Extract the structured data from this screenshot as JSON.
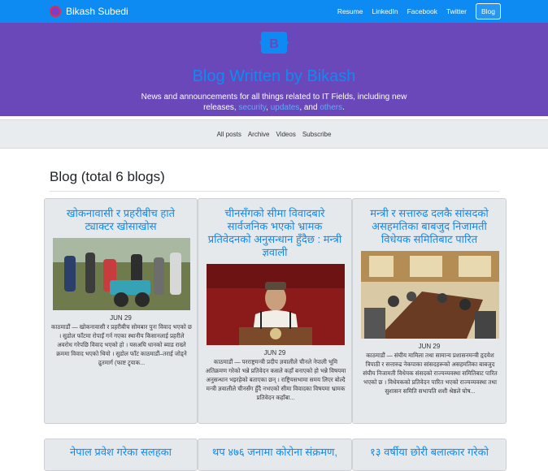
{
  "navbar": {
    "brand": "Bikash Subedi",
    "links": [
      "Resume",
      "LinkedIn",
      "Facebook",
      "Twitter",
      "Blog"
    ]
  },
  "hero": {
    "title": "Blog Written by Bikash",
    "desc_pre": "News and announcements for all things related to IT Fields, including new releases,",
    "link1": "security",
    "sep1": ",",
    "link2": "updates",
    "sep2": ", and",
    "link3": "others",
    "desc_post": "."
  },
  "subnav": [
    "All posts",
    "Archive",
    "Videos",
    "Subscribe"
  ],
  "section_title": "Blog (total 6 blogs)",
  "posts": [
    {
      "title": "खोकनावासी र प्रहरीबीच हाते ट्याक्टर खोसाखोस",
      "date": "JUN 29",
      "excerpt": "काठमाडौं — खोकनावासी र प्रहरीबीच सोमबार पुनः विवाद भएको छ । सुडोल फाँटमा रोपाइँ गर्न गएका स्थानीय किसानलाई प्रहरीले अवरोध गरेपछि विवाद भएको हो । यसअघि धानको ब्याड राख्ने क्रममा विवाद भएको थियो । सुडोल फाँट काठमाडौं–तराई जोड्ने द्रुतमार्ग (फाष्ट ट्र्याक..."
    },
    {
      "title": "चीनसँगको सीमा विवादबारे सार्वजनिक भएको भ्रामक प्रतिवेदनको अनुसन्धान हुँदैछ : मन्त्री ज्ञवाली",
      "date": "JUN 29",
      "excerpt": "काठमाडौं — परराष्ट्रमन्त्री प्रदीप ज्ञवालीले चीनले नेपाली भूमि अतिक्रमण गरेको भन्ने प्रतिवेदन कसले कहाँ बनाएको हो भन्ने विषयमा अनुसन्धान भइरहेको बताएका छन् । राष्ट्रियसभामा समय लिएर बोल्दै मन्त्री ज्ञवालीले चीनसँग हुँदै नभएको सीमा विवादका विषयमा भ्रामक प्रतिवेदन कहाँबा..."
    },
    {
      "title": "मन्त्री र सत्तारुढ दलकै सांसदको असहमतिका बाबजुद निजामती विधेयक समितिबाट पारित",
      "date": "JUN 29",
      "excerpt": "काठमाडौं — संघीय मामिला तथा सामान्य प्रशासनमन्त्री हृदयेश त्रिपाठी र सत्तारुढ नेकपाका सांसदहरूको असहमतिका बाबजुद संघीय निजामती विधेयक संसदको राज्यव्यवस्था समितिबाट पारित भएको छ । विधेयकको प्रतिवेदन पारित भएको राज्यव्यवस्था तथा सुशासन समिति सभापति शशी श्रेष्ठले घोष..."
    },
    {
      "title": "नेपाल प्रवेश गरेका सलहका"
    },
    {
      "title": "थप ४७६ जनामा कोरोना संक्रमण,"
    },
    {
      "title": "१३ वर्षीया छोरी बलात्कार गरेको"
    }
  ]
}
